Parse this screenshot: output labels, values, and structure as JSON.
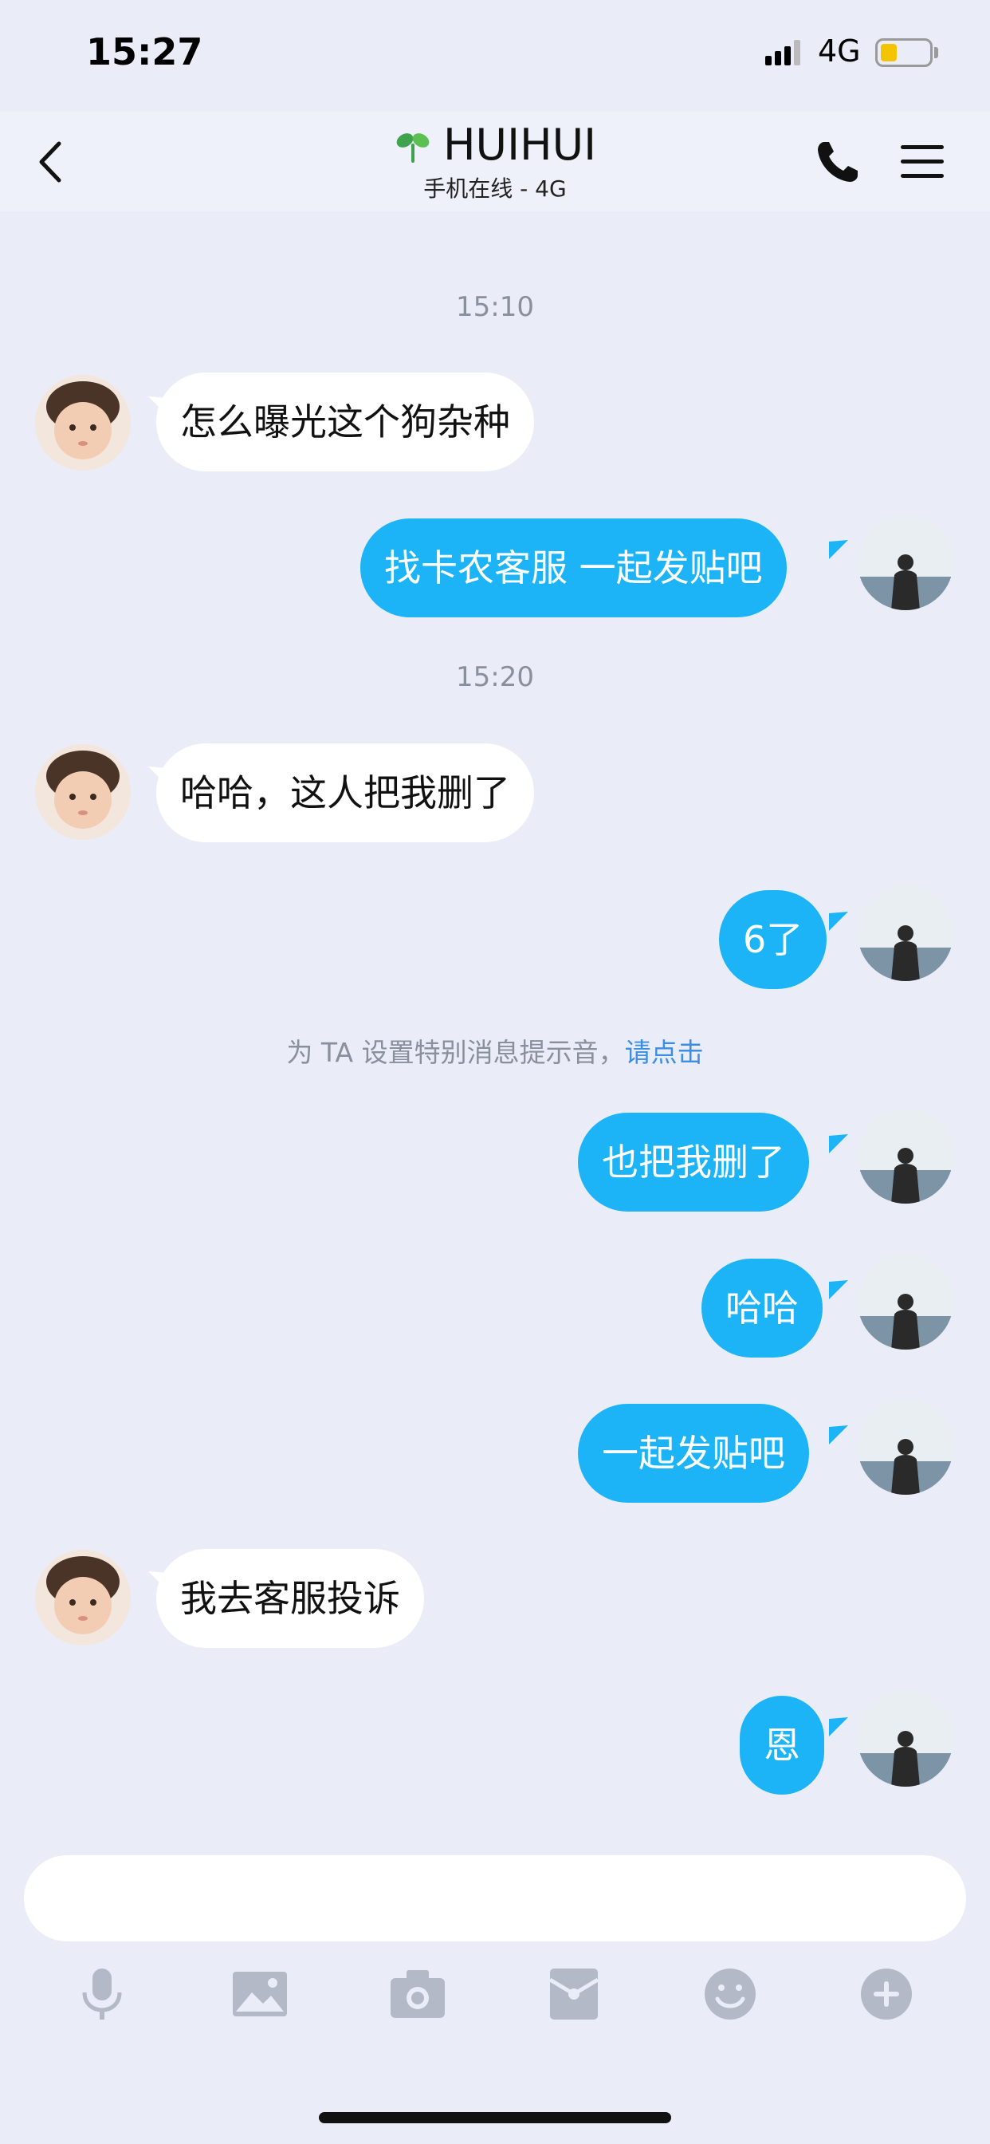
{
  "status_bar": {
    "time": "15:27",
    "network": "4G",
    "battery_color": "#f5c400"
  },
  "header": {
    "title": "HUIHUI",
    "subtitle": "手机在线 - 4G",
    "icons": [
      "back-chevron-icon",
      "sprout-icon",
      "phone-icon",
      "menu-icon"
    ]
  },
  "chat": {
    "timestamps": [
      "15:10",
      "15:20"
    ],
    "notice_text": "为 TA 设置特别消息提示音，",
    "notice_link": "请点击",
    "messages": [
      {
        "side": "in",
        "text": "怎么曝光这个狗杂种"
      },
      {
        "side": "out",
        "text": "找卡农客服 一起发贴吧"
      },
      {
        "side": "in",
        "text": "哈哈，这人把我删了"
      },
      {
        "side": "out",
        "text": "6了"
      },
      {
        "side": "out",
        "text": "也把我删了"
      },
      {
        "side": "out",
        "text": "哈哈"
      },
      {
        "side": "out",
        "text": "一起发贴吧"
      },
      {
        "side": "in",
        "text": "我去客服投诉"
      },
      {
        "side": "out",
        "text": "恩"
      }
    ]
  },
  "input": {
    "value": ""
  },
  "toolbar": {
    "icons": [
      "microphone-icon",
      "image-icon",
      "camera-icon",
      "red-packet-icon",
      "emoji-icon",
      "plus-icon"
    ]
  },
  "colors": {
    "background": "#eaedf8",
    "outgoing_bubble": "#1cb4f7",
    "incoming_bubble": "#ffffff",
    "link": "#3a8ee6",
    "toolbar_icon": "#b4b9c8"
  }
}
